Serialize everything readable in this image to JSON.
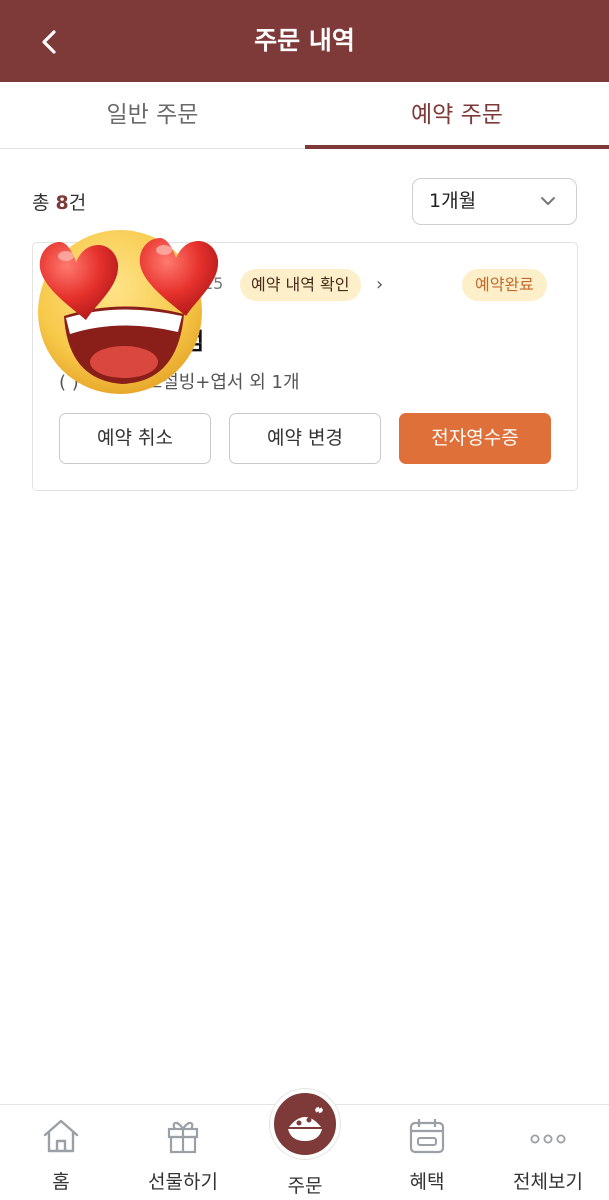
{
  "header": {
    "title": "주문 내역",
    "back_icon": "chevron-left-icon"
  },
  "tabs": [
    {
      "label": "일반 주문",
      "active": false
    },
    {
      "label": "예약 주문",
      "active": true
    }
  ],
  "summary": {
    "total_prefix": "총 ",
    "total_count": "8",
    "total_suffix": "건"
  },
  "filter": {
    "selected": "1개월"
  },
  "order": {
    "date_partial": "15",
    "confirm_label": "예약 내역 확인",
    "confirm_arrow": "›",
    "status": "예약완료",
    "store_partial": "점",
    "items_text": "(  ) 아포..가또설빙+엽서 외 1개",
    "actions": {
      "cancel": "예약 취소",
      "change": "예약 변경",
      "receipt": "전자영수증"
    }
  },
  "overlay": {
    "emoji": "heart-eyes-emoji"
  },
  "bottom_nav": [
    {
      "label": "홈",
      "icon": "home-icon"
    },
    {
      "label": "선물하기",
      "icon": "gift-icon"
    },
    {
      "label": "주문",
      "icon": "bingsu-icon"
    },
    {
      "label": "혜택",
      "icon": "calendar-icon"
    },
    {
      "label": "전체보기",
      "icon": "more-icon"
    }
  ],
  "colors": {
    "brand": "#7d3a39",
    "accent": "#e0703a",
    "badge_bg": "#fcefc9"
  }
}
